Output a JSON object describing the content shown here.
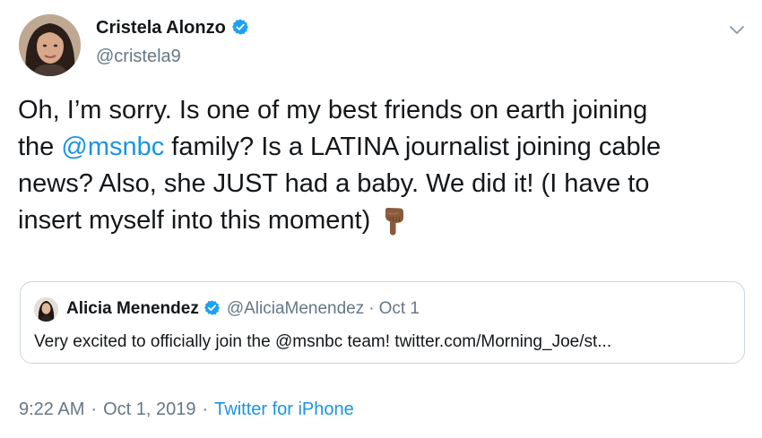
{
  "author": {
    "name": "Cristela Alonzo",
    "handle": "@cristela9",
    "verified": true
  },
  "tweet": {
    "lines": [
      [
        "Oh, I’m sorry. Is one of my best friends on earth joining"
      ],
      [
        "the ",
        "@msnbc",
        " family? Is a LATINA journalist joining cable"
      ],
      [
        "news? Also, she JUST had a baby. We did it! (I have to"
      ],
      [
        "insert myself into this moment)"
      ]
    ],
    "line1": "Oh, I’m sorry. Is one of my best friends on earth joining",
    "line2_prefix": "the ",
    "line2_mention": "@msnbc",
    "line2_suffix": " family? Is a LATINA journalist joining cable",
    "line3": "news? Also, she JUST had a baby. We did it! (I have to",
    "line4": "insert myself into this moment)",
    "emoji": "pointing-down-icon"
  },
  "quote": {
    "name": "Alicia Menendez",
    "handle": "@AliciaMenendez",
    "separator": "·",
    "date": "Oct 1",
    "text": "Very excited to officially join the @msnbc team! twitter.com/Morning_Joe/st..."
  },
  "meta": {
    "time": "9:22 AM",
    "separator": "·",
    "date": "Oct 1, 2019",
    "separator2": "·",
    "source": "Twitter for iPhone"
  },
  "colors": {
    "link": "#1b95e0",
    "secondary_text": "#657786",
    "primary_text": "#14171a",
    "border": "#ccd6dd",
    "verified_badge": "#1da1f2"
  }
}
